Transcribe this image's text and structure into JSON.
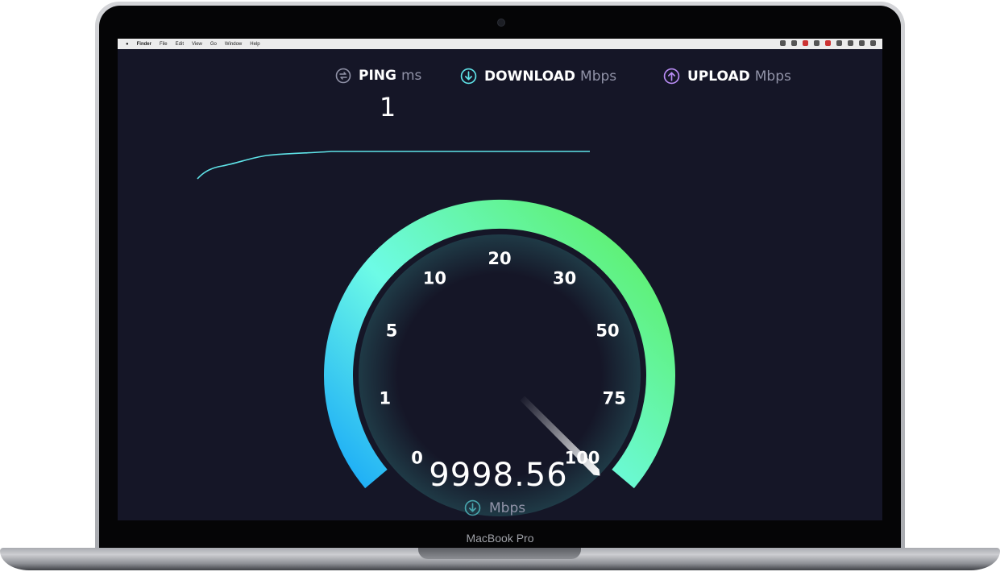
{
  "device": {
    "label": "MacBook Pro"
  },
  "menubar": {
    "items": [
      "Finder",
      "File",
      "Edit",
      "View",
      "Go",
      "Window",
      "Help"
    ]
  },
  "metrics": {
    "ping": {
      "name": "PING",
      "unit": "ms",
      "value": "1",
      "icon": "ping-icon",
      "color": "#ffffff"
    },
    "download": {
      "name": "DOWNLOAD",
      "unit": "Mbps",
      "icon": "download-arrow-icon",
      "color": "#5fe3e8"
    },
    "upload": {
      "name": "UPLOAD",
      "unit": "Mbps",
      "icon": "upload-arrow-icon",
      "color": "#b98cf5"
    }
  },
  "gauge": {
    "ticks": [
      "0",
      "1",
      "5",
      "10",
      "20",
      "30",
      "50",
      "75",
      "100"
    ],
    "value": "9998.56",
    "unit": "Mbps",
    "needle_fraction": 1.0,
    "gradient_colors": [
      "#1aaaf7",
      "#6dfbe6",
      "#5ef070"
    ]
  },
  "colors": {
    "screen_bg": "#151627",
    "graph_line": "#5fe3e8"
  }
}
